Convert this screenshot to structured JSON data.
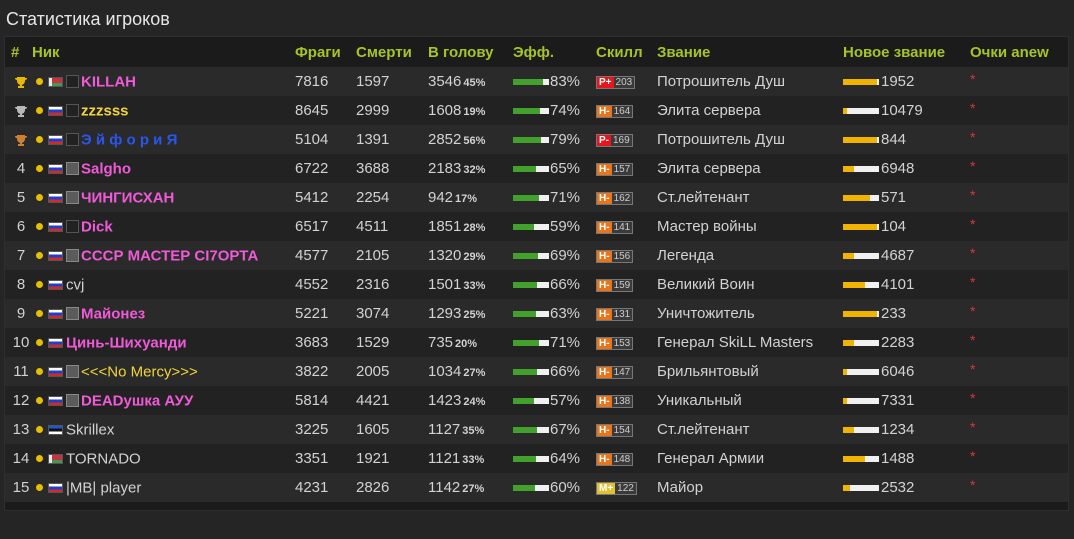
{
  "page_title": "Статистика игроков",
  "columns": {
    "num": "#",
    "nick": "Ник",
    "frags": "Фраги",
    "deaths": "Смерти",
    "hs": "В голову",
    "eff": "Эфф.",
    "skill": "Скилл",
    "rank": "Звание",
    "new_rank": "Новое звание",
    "anew": "Очки anew"
  },
  "colors": {
    "header": "#a5c426",
    "eff_fill": "#42a12c",
    "rank_fill": "#f0b400",
    "star": "#d23a3a"
  },
  "rows": [
    {
      "num": "",
      "trophy": "gold",
      "flag": "by",
      "avatar": "dark",
      "nick": "KILLAH",
      "nick_color": "#f05ad8",
      "bold": true,
      "frags": "7816",
      "deaths": "1597",
      "hs": "3546",
      "hs_pct": "45%",
      "eff": "83%",
      "eff_level": 0.83,
      "skill_grade": "P+",
      "skill_color": "#e8161c",
      "skill_value": "203",
      "rank": "Потрошитель Душ",
      "new_rank": "1952",
      "rank_level": 0.95,
      "anew": "*"
    },
    {
      "num": "",
      "trophy": "silver",
      "flag": "ru",
      "avatar": "dark",
      "nick": "zzzsss",
      "nick_color": "#f2d43a",
      "bold": true,
      "frags": "8645",
      "deaths": "2999",
      "hs": "1608",
      "hs_pct": "19%",
      "eff": "74%",
      "eff_level": 0.74,
      "skill_grade": "H-",
      "skill_color": "#e8741c",
      "skill_value": "164",
      "rank": "Элита сервера",
      "new_rank": "10479",
      "rank_level": 0.1,
      "anew": "*"
    },
    {
      "num": "",
      "trophy": "bronze",
      "flag": "ru",
      "avatar": "dark",
      "nick": "Э й ф о р и Я",
      "nick_color": "#2a56f0",
      "bold": true,
      "frags": "5104",
      "deaths": "1391",
      "hs": "2852",
      "hs_pct": "56%",
      "eff": "79%",
      "eff_level": 0.79,
      "skill_grade": "P-",
      "skill_color": "#e8161c",
      "skill_value": "169",
      "rank": "Потрошитель Душ",
      "new_rank": "844",
      "rank_level": 0.95,
      "anew": "*"
    },
    {
      "num": "4",
      "trophy": "",
      "flag": "ru",
      "avatar": "grey",
      "nick": "Salgho",
      "nick_color": "#f05ad8",
      "bold": true,
      "frags": "6722",
      "deaths": "3688",
      "hs": "2183",
      "hs_pct": "32%",
      "eff": "65%",
      "eff_level": 0.65,
      "skill_grade": "H-",
      "skill_color": "#e8741c",
      "skill_value": "157",
      "rank": "Элита сервера",
      "new_rank": "6948",
      "rank_level": 0.3,
      "anew": "*"
    },
    {
      "num": "5",
      "trophy": "",
      "flag": "ru",
      "avatar": "grey",
      "nick": "ЧИНГИСХАН",
      "nick_color": "#f05ad8",
      "bold": true,
      "frags": "5412",
      "deaths": "2254",
      "hs": "942",
      "hs_pct": "17%",
      "eff": "71%",
      "eff_level": 0.71,
      "skill_grade": "H-",
      "skill_color": "#e8741c",
      "skill_value": "162",
      "rank": "Ст.лейтенант",
      "new_rank": "571",
      "rank_level": 0.75,
      "anew": "*"
    },
    {
      "num": "6",
      "trophy": "",
      "flag": "ru",
      "avatar": "dark",
      "nick": "Dick",
      "nick_color": "#f05ad8",
      "bold": true,
      "frags": "6517",
      "deaths": "4511",
      "hs": "1851",
      "hs_pct": "28%",
      "eff": "59%",
      "eff_level": 0.59,
      "skill_grade": "H-",
      "skill_color": "#e8741c",
      "skill_value": "141",
      "rank": "Мастер войны",
      "new_rank": "104",
      "rank_level": 0.95,
      "anew": "*"
    },
    {
      "num": "7",
      "trophy": "",
      "flag": "ru",
      "avatar": "grey",
      "nick": "СССР МАСТЕР СI7ОРТА",
      "nick_color": "#f05ad8",
      "bold": true,
      "frags": "4577",
      "deaths": "2105",
      "hs": "1320",
      "hs_pct": "29%",
      "eff": "69%",
      "eff_level": 0.69,
      "skill_grade": "H-",
      "skill_color": "#e8741c",
      "skill_value": "156",
      "rank": "Легенда",
      "new_rank": "4687",
      "rank_level": 0.3,
      "anew": "*"
    },
    {
      "num": "8",
      "trophy": "",
      "flag": "ru",
      "avatar": "",
      "nick": "cvj",
      "nick_color": "#d2d2d2",
      "bold": false,
      "frags": "4552",
      "deaths": "2316",
      "hs": "1501",
      "hs_pct": "33%",
      "eff": "66%",
      "eff_level": 0.66,
      "skill_grade": "H-",
      "skill_color": "#e8741c",
      "skill_value": "159",
      "rank": "Великий Воин",
      "new_rank": "4101",
      "rank_level": 0.6,
      "anew": "*"
    },
    {
      "num": "9",
      "trophy": "",
      "flag": "ru",
      "avatar": "grey",
      "nick": "Майонез",
      "nick_color": "#f05ad8",
      "bold": true,
      "frags": "5221",
      "deaths": "3074",
      "hs": "1293",
      "hs_pct": "25%",
      "eff": "63%",
      "eff_level": 0.63,
      "skill_grade": "H-",
      "skill_color": "#e8741c",
      "skill_value": "131",
      "rank": "Уничтожитель",
      "new_rank": "233",
      "rank_level": 0.95,
      "anew": "*"
    },
    {
      "num": "10",
      "trophy": "",
      "flag": "ru",
      "avatar": "",
      "nick": "Цинь-Шихуанди",
      "nick_color": "#f05ad8",
      "bold": true,
      "frags": "3683",
      "deaths": "1529",
      "hs": "735",
      "hs_pct": "20%",
      "eff": "71%",
      "eff_level": 0.71,
      "skill_grade": "H-",
      "skill_color": "#e8741c",
      "skill_value": "153",
      "rank": "Генерал SkiLL Masters",
      "new_rank": "2283",
      "rank_level": 0.3,
      "anew": "*"
    },
    {
      "num": "11",
      "trophy": "",
      "flag": "ru",
      "avatar": "grey",
      "nick": "<<<No Mercy>>>",
      "nick_color": "#f2d43a",
      "bold": false,
      "frags": "3822",
      "deaths": "2005",
      "hs": "1034",
      "hs_pct": "27%",
      "eff": "66%",
      "eff_level": 0.66,
      "skill_grade": "H-",
      "skill_color": "#e8741c",
      "skill_value": "147",
      "rank": "Брильянтовый",
      "new_rank": "6046",
      "rank_level": 0.1,
      "anew": "*"
    },
    {
      "num": "12",
      "trophy": "",
      "flag": "ru",
      "avatar": "grey",
      "nick": "DEADушка АУУ",
      "nick_color": "#f05ad8",
      "bold": true,
      "frags": "5814",
      "deaths": "4421",
      "hs": "1423",
      "hs_pct": "24%",
      "eff": "57%",
      "eff_level": 0.57,
      "skill_grade": "H-",
      "skill_color": "#e8741c",
      "skill_value": "138",
      "rank": "Уникальный",
      "new_rank": "7331",
      "rank_level": 0.1,
      "anew": "*"
    },
    {
      "num": "13",
      "trophy": "",
      "flag": "ee",
      "avatar": "",
      "nick": "Skrillex",
      "nick_color": "#d2d2d2",
      "bold": false,
      "frags": "3225",
      "deaths": "1605",
      "hs": "1127",
      "hs_pct": "35%",
      "eff": "67%",
      "eff_level": 0.67,
      "skill_grade": "H-",
      "skill_color": "#e8741c",
      "skill_value": "154",
      "rank": "Ст.лейтенант",
      "new_rank": "1234",
      "rank_level": 0.3,
      "anew": "*"
    },
    {
      "num": "14",
      "trophy": "",
      "flag": "by",
      "avatar": "",
      "nick": "TORNADO",
      "nick_color": "#d2d2d2",
      "bold": false,
      "frags": "3351",
      "deaths": "1921",
      "hs": "1121",
      "hs_pct": "33%",
      "eff": "64%",
      "eff_level": 0.64,
      "skill_grade": "H-",
      "skill_color": "#e8741c",
      "skill_value": "148",
      "rank": "Генерал Армии",
      "new_rank": "1488",
      "rank_level": 0.6,
      "anew": "*"
    },
    {
      "num": "15",
      "trophy": "",
      "flag": "ru",
      "avatar": "",
      "nick": "|MB| player",
      "nick_color": "#d2d2d2",
      "bold": false,
      "frags": "4231",
      "deaths": "2826",
      "hs": "1142",
      "hs_pct": "27%",
      "eff": "60%",
      "eff_level": 0.6,
      "skill_grade": "M+",
      "skill_color": "#e0c030",
      "skill_value": "122",
      "rank": "Майор",
      "new_rank": "2532",
      "rank_level": 0.2,
      "anew": "*"
    }
  ]
}
